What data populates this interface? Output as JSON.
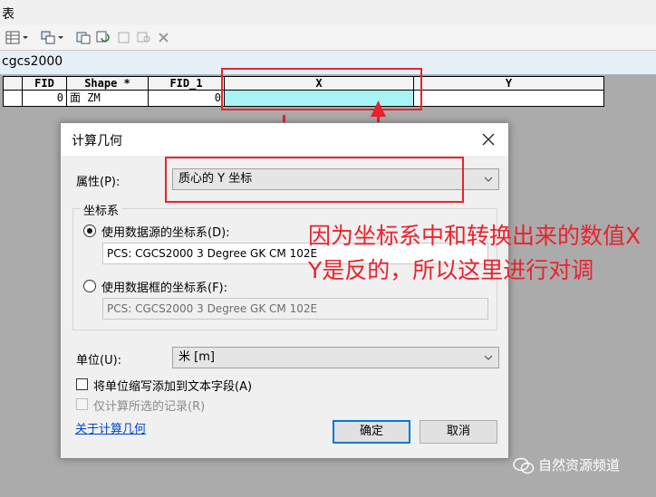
{
  "window": {
    "title": "表"
  },
  "table": {
    "tab_name": "cgcs2000",
    "columns": [
      "FID",
      "Shape *",
      "FID_1",
      "X",
      "Y"
    ],
    "rows": [
      {
        "fid": "0",
        "shape": "面 ZM",
        "fid_1": "0",
        "x": "",
        "y": ""
      }
    ]
  },
  "dialog": {
    "title": "计算几何",
    "property_label": "属性(P):",
    "property_value": "质心的 Y 坐标",
    "coord_group_label": "坐标系",
    "option_source_label": "使用数据源的坐标系(D):",
    "option_source_value": "PCS: CGCS2000 3 Degree GK CM 102E",
    "option_frame_label": "使用数据框的坐标系(F):",
    "option_frame_value": "PCS: CGCS2000 3 Degree GK CM 102E",
    "unit_label": "单位(U):",
    "unit_value": "米 [m]",
    "add_abbrev_label": "将单位缩写添加到文本字段(A)",
    "selected_only_label": "仅计算所选的记录(R)",
    "about_link": "关于计算几何",
    "ok_label": "确定",
    "cancel_label": "取消"
  },
  "annotation": {
    "text": "因为坐标系中和转换出来的数值X Y是反的，所以这里进行对调",
    "color": "#e8232e"
  },
  "watermark": {
    "text": "自然资源频道"
  },
  "colors": {
    "highlight_cell": "#a8f4f4",
    "annotation_red": "#e8232e",
    "link": "#0046c8"
  }
}
